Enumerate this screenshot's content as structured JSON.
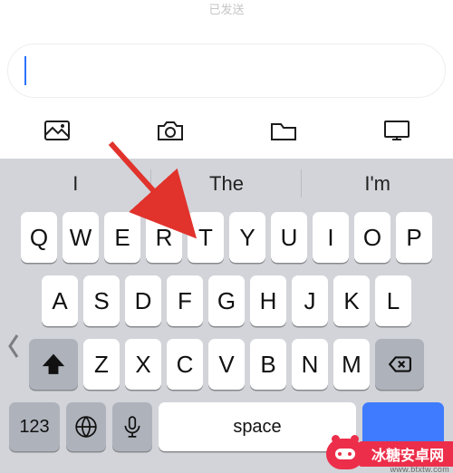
{
  "top": {
    "status_text": "已发送",
    "input_value": ""
  },
  "toolbar_icons": [
    "image-icon",
    "camera-icon",
    "folder-icon",
    "screen-icon"
  ],
  "suggestions": [
    "I",
    "The",
    "I'm"
  ],
  "keys": {
    "row1": [
      "Q",
      "W",
      "E",
      "R",
      "T",
      "Y",
      "U",
      "I",
      "O",
      "P"
    ],
    "row2": [
      "A",
      "S",
      "D",
      "F",
      "G",
      "H",
      "J",
      "K",
      "L"
    ],
    "row3": [
      "Z",
      "X",
      "C",
      "V",
      "B",
      "N",
      "M"
    ]
  },
  "bottom": {
    "num_label": "123",
    "space_label": "space",
    "send_label": ""
  },
  "arrow": {
    "color": "#e1322c"
  },
  "watermark": {
    "text": "冰糖安卓网",
    "sub": "www.btxtw.com"
  }
}
